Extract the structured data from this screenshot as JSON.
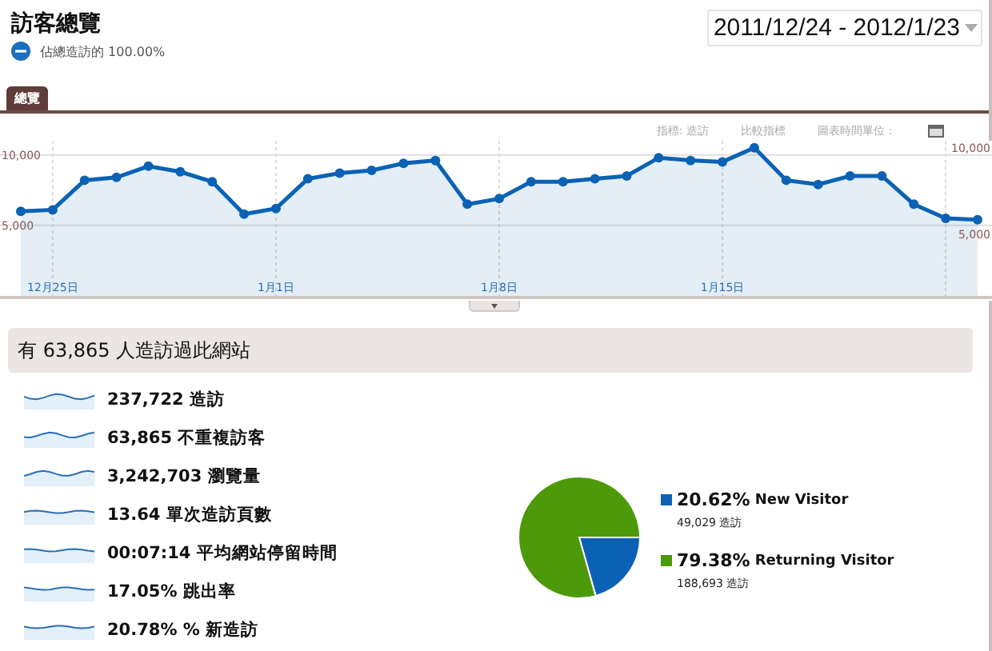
{
  "header": {
    "title": "訪客總覽",
    "subtitle": "佔總造訪的 100.00%",
    "date_range": "2011/12/24 - 2012/1/23"
  },
  "tabs": [
    {
      "label": "總覽",
      "selected": true
    }
  ],
  "toolbar": [
    "指標: 造訪",
    "比較指標",
    "圖表時間單位："
  ],
  "trend": {
    "chart_data": {
      "type": "area",
      "categories": [
        null,
        "12月25日",
        null,
        null,
        null,
        null,
        null,
        null,
        "1月1日",
        null,
        null,
        null,
        null,
        null,
        null,
        "1月8日",
        null,
        null,
        null,
        null,
        null,
        null,
        "1月15日",
        null,
        null,
        null,
        null,
        null,
        null,
        null,
        null
      ],
      "series": [
        {
          "color": "#0b62b5",
          "values": [
            6000,
            6100,
            8200,
            8400,
            9200,
            8800,
            8100,
            5800,
            6200,
            8300,
            8700,
            8900,
            9400,
            9600,
            6500,
            6900,
            8100,
            8100,
            8300,
            8500,
            9800,
            9600,
            9500,
            10500,
            8200,
            7900,
            8500,
            8500,
            6500,
            5500,
            5400
          ]
        }
      ],
      "yticks": [
        {
          "value": 5000,
          "label": "5,000"
        },
        {
          "value": 10000,
          "label": "10,000"
        }
      ],
      "ylim": [
        0,
        11000
      ],
      "grid": true
    }
  },
  "summary": {
    "heading": "有 63,865 人造訪過此網站",
    "metrics": [
      {
        "value": "237,722",
        "label": "造訪"
      },
      {
        "value": "63,865",
        "label": "不重複訪客"
      },
      {
        "value": "3,242,703",
        "label": "瀏覽量"
      },
      {
        "value": "13.64",
        "label": "單次造訪頁數"
      },
      {
        "value": "00:07:14",
        "label": "平均網站停留時間"
      },
      {
        "value": "17.05%",
        "label": "跳出率"
      },
      {
        "value": "20.78%",
        "label": "% 新造訪"
      }
    ]
  },
  "visitor_types": {
    "chart_data": {
      "type": "pie",
      "categories": [
        "New Visitor",
        "Returning Visitor"
      ],
      "series": [
        {
          "values": [
            20.62,
            79.38
          ]
        }
      ]
    },
    "legend": [
      {
        "percent": "20.62%",
        "count": "49,029 造訪",
        "color": "#0b62b5"
      },
      {
        "percent": "79.38%",
        "count": "188,693 造訪",
        "color": "#4c9a0a"
      }
    ]
  }
}
